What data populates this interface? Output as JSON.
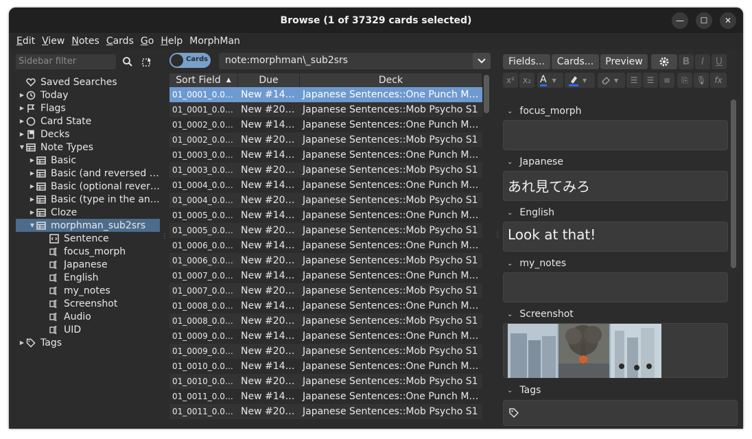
{
  "window": {
    "title": "Browse (1 of 37329 cards selected)"
  },
  "menu": [
    {
      "u": "E",
      "rest": "dit"
    },
    {
      "u": "V",
      "rest": "iew"
    },
    {
      "u": "N",
      "rest": "otes"
    },
    {
      "u": "C",
      "rest": "ards"
    },
    {
      "u": "G",
      "rest": "o"
    },
    {
      "u": "H",
      "rest": "elp"
    },
    {
      "u": "",
      "rest": "MorphMan"
    }
  ],
  "sidebar": {
    "filter_placeholder": "Sidebar filter",
    "items": [
      {
        "label": "Saved Searches",
        "icon": "heart-icon",
        "level": 0,
        "arrow": ""
      },
      {
        "label": "Today",
        "icon": "clock-icon",
        "level": 0,
        "arrow": "▶"
      },
      {
        "label": "Flags",
        "icon": "flag-icon",
        "level": 0,
        "arrow": "▶"
      },
      {
        "label": "Card State",
        "icon": "circle-icon",
        "level": 0,
        "arrow": "▶"
      },
      {
        "label": "Decks",
        "icon": "deck-icon",
        "level": 0,
        "arrow": "▶"
      },
      {
        "label": "Note Types",
        "icon": "notetype-icon",
        "level": 0,
        "arrow": "▼"
      },
      {
        "label": "Basic",
        "icon": "notetype-icon",
        "level": 1,
        "arrow": "▶"
      },
      {
        "label": "Basic (and reversed card)",
        "icon": "notetype-icon",
        "level": 1,
        "arrow": "▶"
      },
      {
        "label": "Basic (optional reversed card)",
        "icon": "notetype-icon",
        "level": 1,
        "arrow": "▶"
      },
      {
        "label": "Basic (type in the answer)",
        "icon": "notetype-icon",
        "level": 1,
        "arrow": "▶"
      },
      {
        "label": "Cloze",
        "icon": "notetype-icon",
        "level": 1,
        "arrow": "▶"
      },
      {
        "label": "morphman_sub2srs",
        "icon": "notetype-icon",
        "level": 1,
        "arrow": "▼",
        "selected": true
      },
      {
        "label": "Sentence",
        "icon": "template-icon",
        "level": 2,
        "arrow": ""
      },
      {
        "label": "focus_morph",
        "icon": "field-icon",
        "level": 2,
        "arrow": ""
      },
      {
        "label": "Japanese",
        "icon": "field-icon",
        "level": 2,
        "arrow": ""
      },
      {
        "label": "English",
        "icon": "field-icon",
        "level": 2,
        "arrow": ""
      },
      {
        "label": "my_notes",
        "icon": "field-icon",
        "level": 2,
        "arrow": ""
      },
      {
        "label": "Screenshot",
        "icon": "field-icon",
        "level": 2,
        "arrow": ""
      },
      {
        "label": "Audio",
        "icon": "field-icon",
        "level": 2,
        "arrow": ""
      },
      {
        "label": "UID",
        "icon": "field-icon",
        "level": 2,
        "arrow": ""
      },
      {
        "label": "Tags",
        "icon": "tag-icon",
        "level": 0,
        "arrow": "▶"
      }
    ]
  },
  "search": {
    "toggle_label": "Cards",
    "query": "note:morphman\\_sub2srs"
  },
  "table": {
    "columns": [
      "Sort Field",
      "Due",
      "Deck"
    ],
    "sort_indicator": "▲",
    "rows": [
      [
        "01_0001_0.00.…",
        "New #14…",
        "Japanese Sentences::One Punch Ma…"
      ],
      [
        "01_0001_0.01.…",
        "New #20…",
        "Japanese Sentences::Mob Psycho S1"
      ],
      [
        "01_0002_0.00.…",
        "New #14…",
        "Japanese Sentences::One Punch Ma…"
      ],
      [
        "01_0002_0.01.…",
        "New #20…",
        "Japanese Sentences::Mob Psycho S1"
      ],
      [
        "01_0003_0.00.…",
        "New #14…",
        "Japanese Sentences::One Punch Ma…"
      ],
      [
        "01_0003_0.01.…",
        "New #20…",
        "Japanese Sentences::Mob Psycho S1"
      ],
      [
        "01_0004_0.00.…",
        "New #14…",
        "Japanese Sentences::One Punch Ma…"
      ],
      [
        "01_0004_0.02.…",
        "New #20…",
        "Japanese Sentences::Mob Psycho S1"
      ],
      [
        "01_0005_0.01.…",
        "New #14…",
        "Japanese Sentences::One Punch Ma…"
      ],
      [
        "01_0005_0.02.…",
        "New #20…",
        "Japanese Sentences::Mob Psycho S1"
      ],
      [
        "01_0006_0.01.…",
        "New #14…",
        "Japanese Sentences::One Punch Ma…"
      ],
      [
        "01_0006_0.02.…",
        "New #20…",
        "Japanese Sentences::Mob Psycho S1"
      ],
      [
        "01_0007_0.01.…",
        "New #14…",
        "Japanese Sentences::One Punch Ma…"
      ],
      [
        "01_0007_0.02.…",
        "New #20…",
        "Japanese Sentences::Mob Psycho S1"
      ],
      [
        "01_0008_0.01.…",
        "New #14…",
        "Japanese Sentences::One Punch Ma…"
      ],
      [
        "01_0008_0.02.…",
        "New #20…",
        "Japanese Sentences::Mob Psycho S1"
      ],
      [
        "01_0009_0.01.…",
        "New #14…",
        "Japanese Sentences::One Punch Ma…"
      ],
      [
        "01_0009_0.02.…",
        "New #20…",
        "Japanese Sentences::Mob Psycho S1"
      ],
      [
        "01_0010_0.01.…",
        "New #14…",
        "Japanese Sentences::One Punch Ma…"
      ],
      [
        "01_0010_0.02.…",
        "New #20…",
        "Japanese Sentences::Mob Psycho S1"
      ],
      [
        "01_0011_0.01.…",
        "New #14…",
        "Japanese Sentences::One Punch Ma…"
      ],
      [
        "01_0011_0.02.…",
        "New #20…",
        "Japanese Sentences::Mob Psycho S1"
      ]
    ]
  },
  "editor": {
    "fields_button": "Fields...",
    "cards_button": "Cards...",
    "preview_button": "Preview",
    "bold": "B",
    "italic": "I",
    "underline": "U",
    "superscript": "x²",
    "subscript": "x₂",
    "text_color": "A",
    "mathjax": "fx",
    "fields": [
      {
        "name": "focus_morph",
        "value": ""
      },
      {
        "name": "Japanese",
        "value": "あれ見てみろ"
      },
      {
        "name": "English",
        "value": "Look at that!"
      },
      {
        "name": "my_notes",
        "value": ""
      },
      {
        "name": "Screenshot",
        "value": ""
      }
    ],
    "tags_label": "Tags"
  },
  "colors": {
    "selection": "#6d9ad0",
    "sidebar_selection": "#4c6c8c",
    "toggle": "#7aa0c8",
    "accent_blue": "#2f6bff"
  }
}
